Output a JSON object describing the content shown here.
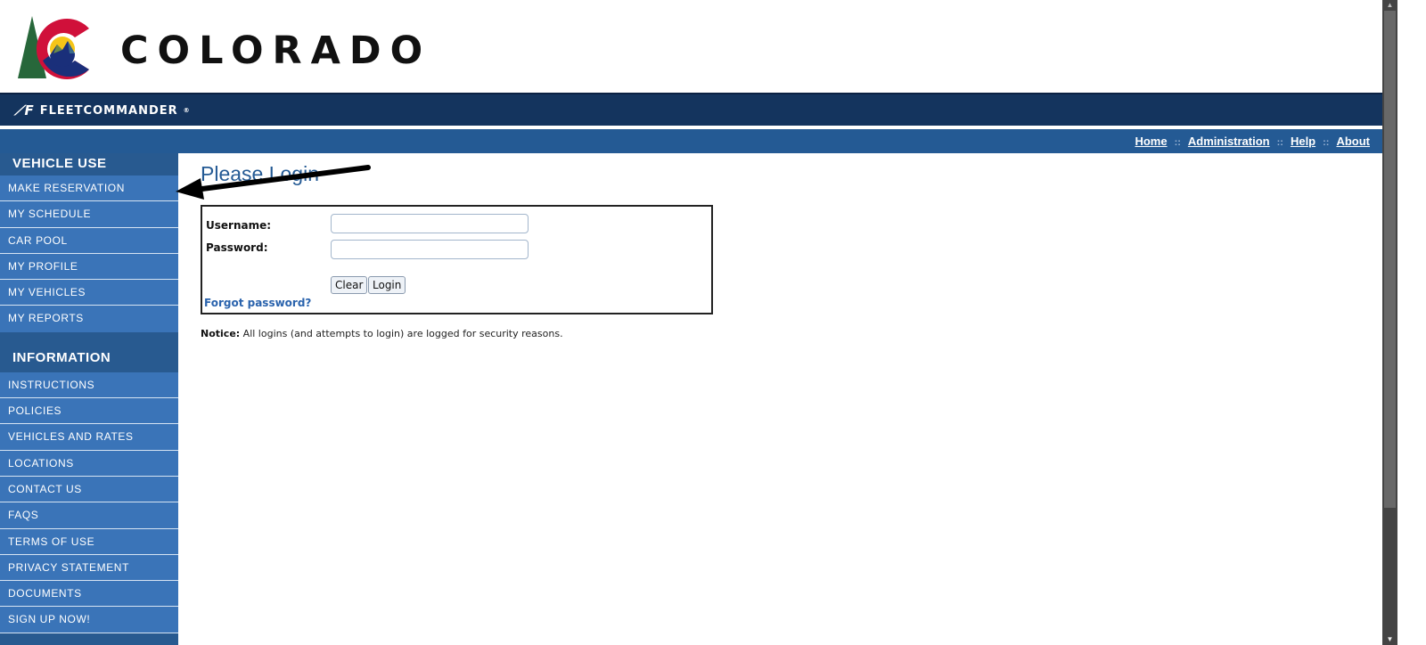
{
  "brand": {
    "state_name": "COLORADO",
    "app_name": "FLEETCOMMANDER",
    "trademark": "®"
  },
  "top_nav": {
    "links": [
      "Home",
      "Administration",
      "Help",
      "About"
    ],
    "separator": "::"
  },
  "sidebar": {
    "sections": [
      {
        "title": "VEHICLE USE",
        "items": [
          "MAKE RESERVATION",
          "MY SCHEDULE",
          "CAR POOL",
          "MY PROFILE",
          "MY VEHICLES",
          "MY REPORTS"
        ]
      },
      {
        "title": "INFORMATION",
        "items": [
          "INSTRUCTIONS",
          "POLICIES",
          "VEHICLES AND RATES",
          "LOCATIONS",
          "CONTACT US",
          "FAQS",
          "TERMS OF USE",
          "PRIVACY STATEMENT",
          "DOCUMENTS",
          "SIGN UP NOW!"
        ]
      }
    ]
  },
  "login": {
    "title": "Please Login",
    "username_label": "Username:",
    "username_value": "",
    "password_label": "Password:",
    "password_value": "",
    "clear_label": "Clear",
    "login_label": "Login",
    "forgot_label": "Forgot password?"
  },
  "notice": {
    "label": "Notice:",
    "text": " All logins (and attempts to login) are logged for security reasons."
  },
  "annotation": {
    "arrow_target": "MAKE RESERVATION"
  },
  "colors": {
    "header_dark": "#14345e",
    "nav_blue": "#245a94",
    "sidebar_item": "#3a74b8",
    "link_blue": "#2a63ad"
  }
}
